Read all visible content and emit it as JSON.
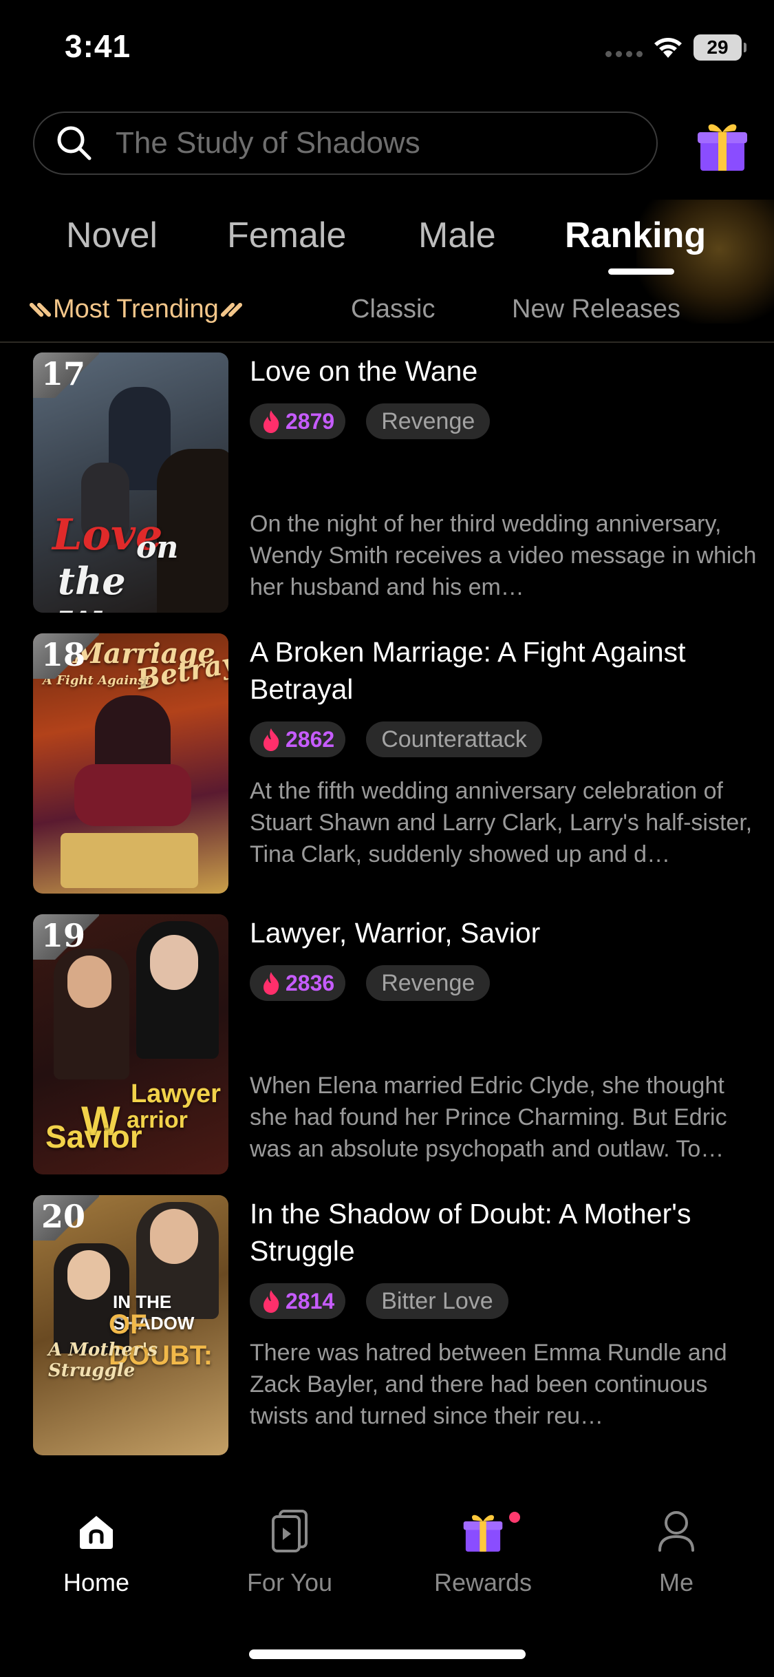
{
  "status_bar": {
    "time": "3:41",
    "battery": "29"
  },
  "search": {
    "placeholder": "The Study of Shadows"
  },
  "category_tabs": [
    {
      "label": "Novel"
    },
    {
      "label": "Female"
    },
    {
      "label": "Male"
    },
    {
      "label": "Ranking"
    }
  ],
  "active_category": "Ranking",
  "sub_tabs": [
    {
      "label": "Most Trending"
    },
    {
      "label": "Classic"
    },
    {
      "label": "New Releases"
    }
  ],
  "active_sub_tab": "Most Trending",
  "books": [
    {
      "rank": "17",
      "title": "Love on the Wane",
      "heat": "2879",
      "tag": "Revenge",
      "description": "On the night of her third wedding anniversary, Wendy Smith receives a video message in which her husband and his em…"
    },
    {
      "rank": "18",
      "title": "A Broken Marriage: A Fight Against Betrayal",
      "heat": "2862",
      "tag": "Counterattack",
      "description": "At the fifth wedding anniversary celebration of Stuart Shawn and Larry Clark, Larry's half-sister, Tina Clark, suddenly showed up and d…"
    },
    {
      "rank": "19",
      "title": "Lawyer, Warrior, Savior",
      "heat": "2836",
      "tag": "Revenge",
      "description": "When Elena married Edric Clyde, she thought she had found her Prince Charming. But Edric was an absolute psychopath and outlaw. To…"
    },
    {
      "rank": "20",
      "title": "In the Shadow of Doubt: A Mother's Struggle",
      "heat": "2814",
      "tag": "Bitter Love",
      "description": "There was hatred between Emma Rundle and Zack Bayler, and there had been continuous twists and turned since their reu…"
    }
  ],
  "bottom_nav": [
    {
      "label": "Home",
      "icon": "home-icon"
    },
    {
      "label": "For You",
      "icon": "for-you-icon"
    },
    {
      "label": "Rewards",
      "icon": "gift-icon"
    },
    {
      "label": "Me",
      "icon": "person-icon"
    }
  ],
  "active_nav": "Home",
  "colors": {
    "accent_purple": "#c65cff",
    "trending_gold": "#f3c68a",
    "background": "#000000"
  }
}
